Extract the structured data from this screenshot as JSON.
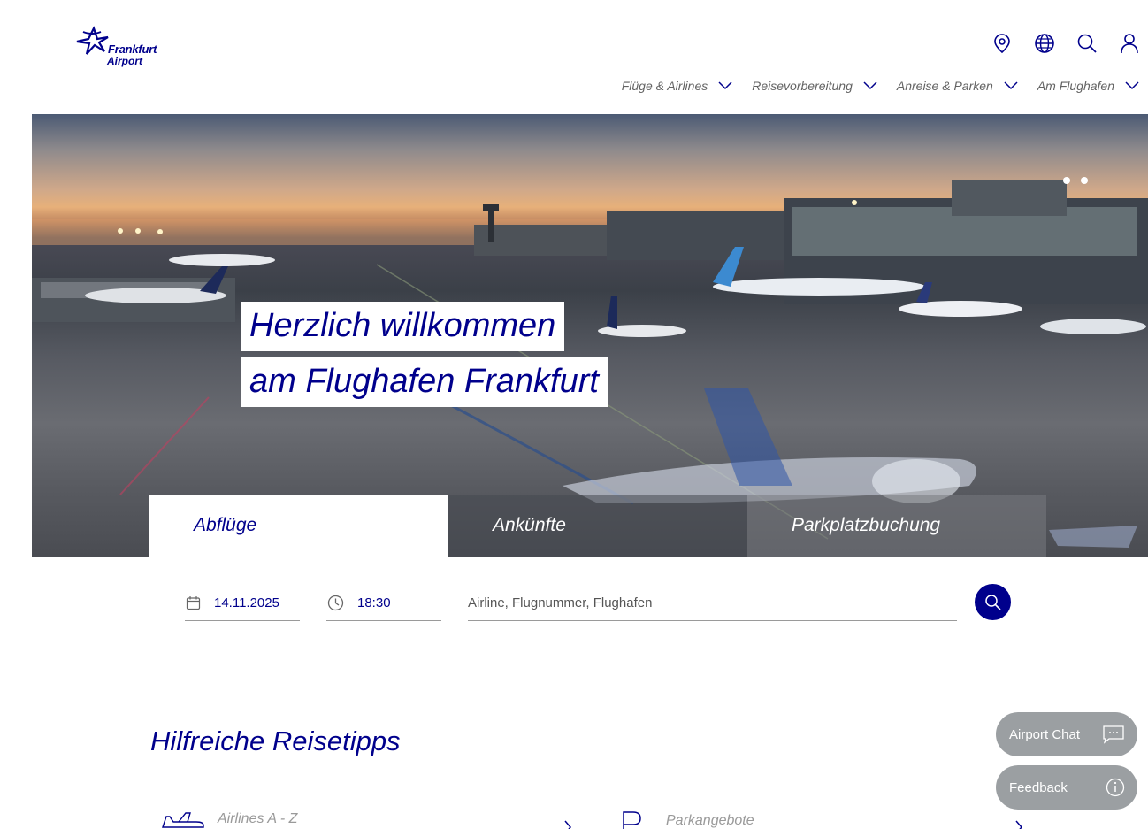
{
  "brand": {
    "logo_line1": "Frankfurt",
    "logo_line2": "Airport",
    "color": "#00008c"
  },
  "header_icons": [
    "location-icon",
    "globe-icon",
    "search-icon",
    "user-icon"
  ],
  "nav": {
    "items": [
      {
        "label": "Flüge & Airlines"
      },
      {
        "label": "Reisevorbereitung"
      },
      {
        "label": "Anreise & Parken"
      },
      {
        "label": "Am Flughafen"
      }
    ]
  },
  "hero": {
    "title_line1": "Herzlich willkommen",
    "title_line2": "am Flughafen Frankfurt"
  },
  "tabs": [
    {
      "label": "Abflüge",
      "active": true
    },
    {
      "label": "Ankünfte",
      "active": false
    },
    {
      "label": "Parkplatzbuchung",
      "active": false
    }
  ],
  "search": {
    "date": "14.11.2025",
    "time": "18:30",
    "query_placeholder": "Airline, Flugnummer, Flughafen",
    "query_value": ""
  },
  "section": {
    "title": "Hilfreiche Reisetipps",
    "tips": [
      {
        "label": "Airlines A - Z",
        "icon": "airplane-icon"
      },
      {
        "label": "Parkangebote",
        "icon": "parking-icon"
      }
    ]
  },
  "floating": {
    "chat_label": "Airport Chat",
    "feedback_label": "Feedback",
    "bg_color": "#9b9fa2"
  }
}
